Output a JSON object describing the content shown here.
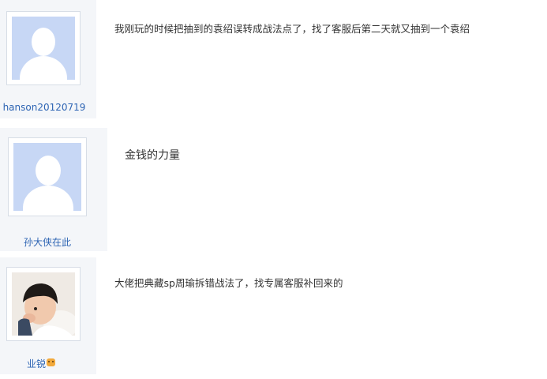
{
  "posts": [
    {
      "username": "hanson20120719",
      "content": "我刚玩的时候把抽到的袁绍误转成战法点了，找了客服后第二天就又抽到一个袁绍",
      "avatar": "default-avatar"
    },
    {
      "username": "孙大侠在此",
      "content": "金钱的力量",
      "avatar": "default-avatar"
    },
    {
      "username": "业锐",
      "username_badge": "tiger-face-icon",
      "content": "大佬把典藏sp周瑜拆错战法了，找专属客服补回来的",
      "avatar": "child-photo-avatar"
    }
  ],
  "colors": {
    "username": "#2d64b3",
    "avatar_bg": "#c7d7f5",
    "sidebar_bg": "#f4f6f9"
  }
}
